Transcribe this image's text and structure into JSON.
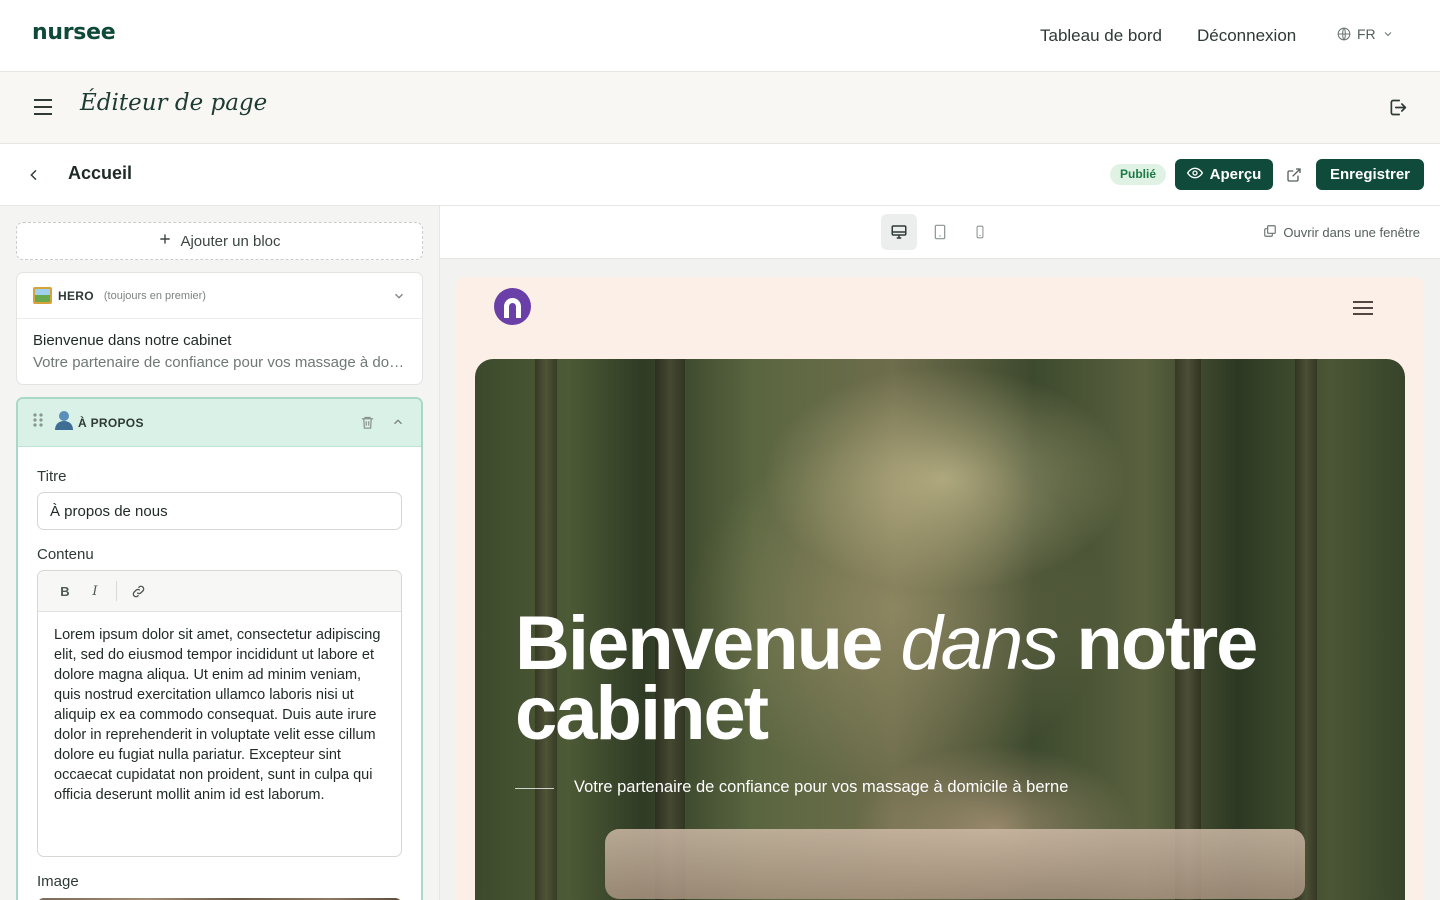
{
  "topnav": {
    "brand": "nursee",
    "dashboard": "Tableau de bord",
    "logout": "Déconnexion",
    "lang": "FR"
  },
  "editor": {
    "title": "Éditeur de page"
  },
  "pagebar": {
    "page_name": "Accueil",
    "status": "Publié",
    "preview_label": "Aperçu",
    "save_label": "Enregistrer"
  },
  "blocks": {
    "add_block": "Ajouter un bloc",
    "hero": {
      "tag": "HERO",
      "note": "(toujours en premier)",
      "title": "Bienvenue dans notre cabinet",
      "subtitle": "Votre partenaire de confiance pour vos massage à domicile à berne"
    },
    "about": {
      "tag": "À PROPOS",
      "title_label": "Titre",
      "title_value": "À propos de nous",
      "content_label": "Contenu",
      "content": "Lorem ipsum dolor sit amet, consectetur adipiscing elit, sed do eiusmod tempor incididunt ut labore et dolore magna aliqua. Ut enim ad minim veniam, quis nostrud exercitation ullamco laboris nisi ut aliquip ex ea commodo consequat. Duis aute irure dolor in reprehenderit in voluptate velit esse cillum dolore eu fugiat nulla pariatur. Excepteur sint occaecat cupidatat non proident, sunt in culpa qui officia deserunt mollit anim id est laborum.",
      "image_label": "Image"
    }
  },
  "preview": {
    "open_window": "Ouvrir dans une fenêtre",
    "devices": [
      "desktop-icon",
      "tablet-icon",
      "mobile-icon"
    ],
    "active_device": "desktop",
    "hero_word1": "Bienvenue",
    "hero_word2": "dans",
    "hero_word3": "notre",
    "hero_word4": "cabinet",
    "hero_sub": "Votre partenaire de confiance pour vos massage à domicile à berne"
  },
  "colors": {
    "brand": "#0e4a37",
    "primary_button": "#0f4a3a",
    "badge_bg": "#dff2e4",
    "badge_text": "#1b7a45",
    "active_block_bg": "#d9f1e7",
    "site_bg": "#fbefe8",
    "site_logo": "#6b3fa8"
  }
}
